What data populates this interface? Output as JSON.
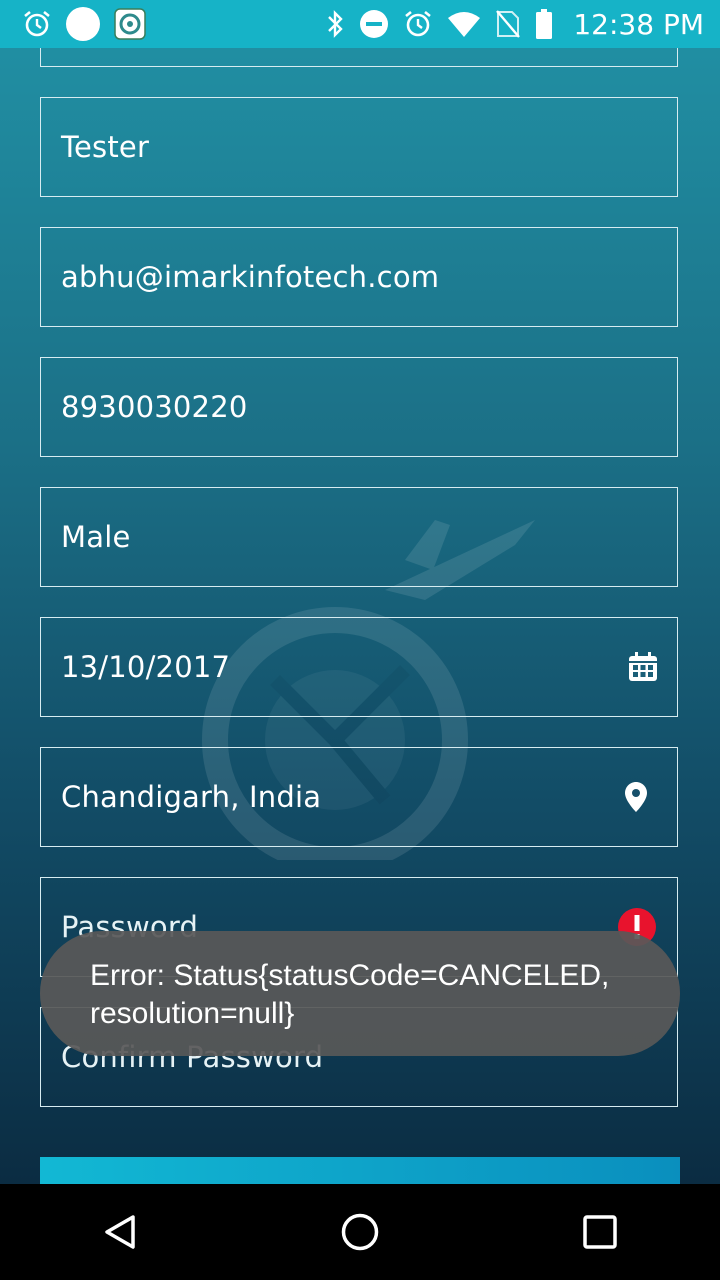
{
  "status_bar": {
    "time": "12:38 PM",
    "left_icons": [
      "alarm-icon",
      "circle-notification-icon",
      "app-notification-icon"
    ],
    "right_icons": [
      "bluetooth-icon",
      "do-not-disturb-icon",
      "alarm-icon",
      "wifi-icon",
      "no-sim-icon",
      "battery-icon"
    ],
    "background": "#16b3c7"
  },
  "form": {
    "designation": "Tester",
    "email": "abhu@imarkinfotech.com",
    "phone": "8930030220",
    "gender": "Male",
    "date": "13/10/2017",
    "location": "Chandigarh, India",
    "password_placeholder": "Password",
    "confirm_password_placeholder": "Confirm Password"
  },
  "toast": {
    "line1": "Error: Status{statusCode=CANCELED,",
    "line2": "resolution=null}"
  },
  "colors": {
    "gradient_top": "#2192a6",
    "gradient_bottom": "#0b2c42",
    "field_border": "#d7ecf1",
    "error_icon": "#e8132d",
    "submit_button": "#12b8d4"
  },
  "nav_bar": {
    "buttons": [
      "back-icon",
      "home-icon",
      "recents-icon"
    ]
  }
}
